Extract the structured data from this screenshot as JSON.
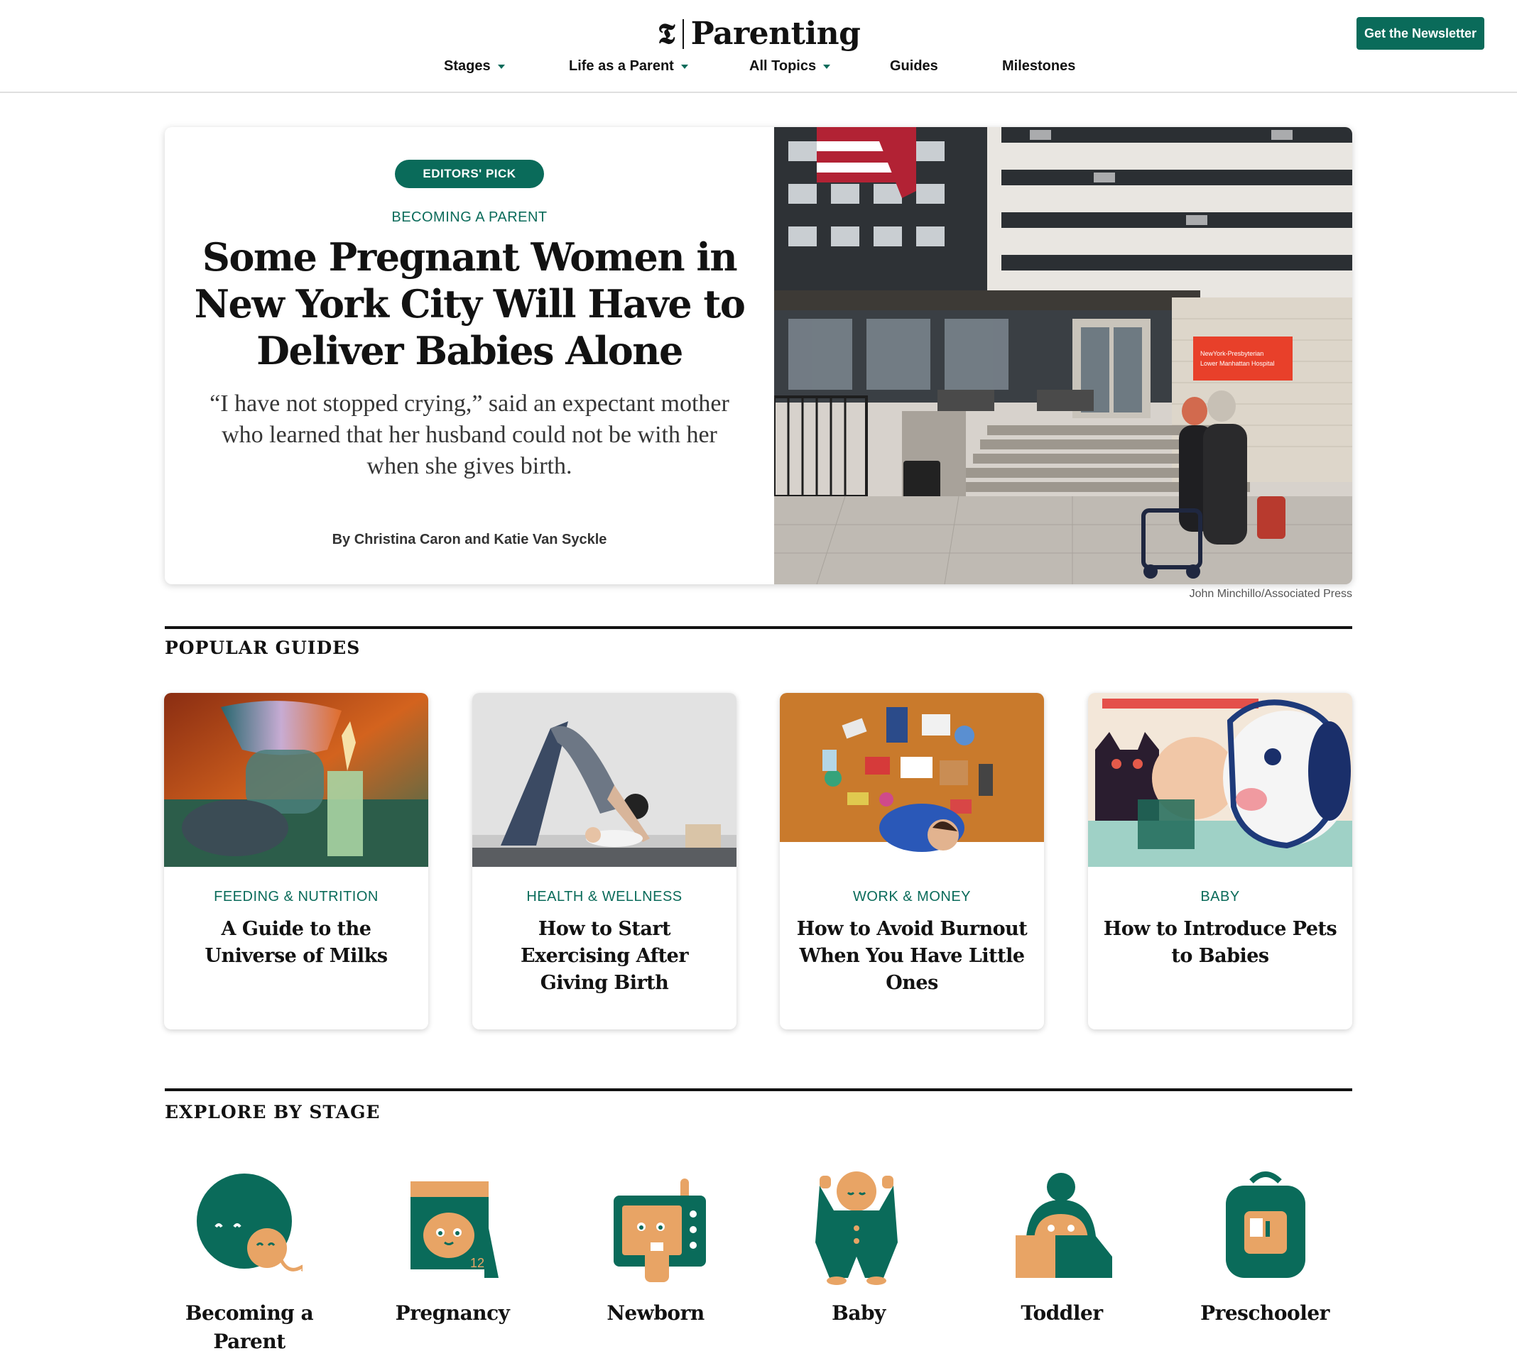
{
  "header": {
    "logo_mark": "𝕿",
    "logo_word": "Parenting",
    "newsletter_label": "Get the Newsletter",
    "nav": [
      {
        "label": "Stages",
        "dropdown": true
      },
      {
        "label": "Life as a Parent",
        "dropdown": true
      },
      {
        "label": "All Topics",
        "dropdown": true
      },
      {
        "label": "Guides",
        "dropdown": false
      },
      {
        "label": "Milestones",
        "dropdown": false
      }
    ]
  },
  "hero": {
    "badge": "EDITORS' PICK",
    "kicker": "BECOMING A PARENT",
    "title": "Some Pregnant Women in New York City Will Have to Deliver Babies Alone",
    "summary": "“I have not stopped crying,” said an expectant mother who learned that her husband could not be with her when she gives birth.",
    "byline": "By Christina Caron and Katie Van Syckle",
    "photo_sign": "NewYork-Presbyterian | Lower Manhattan Hospital",
    "photo_credit": "John Minchillo/Associated Press"
  },
  "popular_guides": {
    "heading": "POPULAR GUIDES",
    "cards": [
      {
        "kicker": "FEEDING & NUTRITION",
        "title": "A Guide to the Universe of Milks"
      },
      {
        "kicker": "HEALTH & WELLNESS",
        "title": "How to Start Exercising After Giving Birth"
      },
      {
        "kicker": "WORK & MONEY",
        "title": "How to Avoid Burnout When You Have Little Ones"
      },
      {
        "kicker": "BABY",
        "title": "How to Introduce Pets to Babies"
      }
    ]
  },
  "explore_by_stage": {
    "heading": "EXPLORE BY STAGE",
    "stages": [
      {
        "label": "Becoming a Parent",
        "icon": "sperm-egg-icon"
      },
      {
        "label": "Pregnancy",
        "icon": "calendar-baby-icon"
      },
      {
        "label": "Newborn",
        "icon": "baby-monitor-icon"
      },
      {
        "label": "Baby",
        "icon": "baby-onesie-icon"
      },
      {
        "label": "Toddler",
        "icon": "toddler-blocks-icon"
      },
      {
        "label": "Preschooler",
        "icon": "backpack-icon"
      }
    ],
    "icon_colors": {
      "green": "#0a6b5a",
      "orange": "#e8a465"
    }
  },
  "colors": {
    "accent": "#0a6b5a",
    "text": "#121212",
    "rule": "#121212"
  }
}
